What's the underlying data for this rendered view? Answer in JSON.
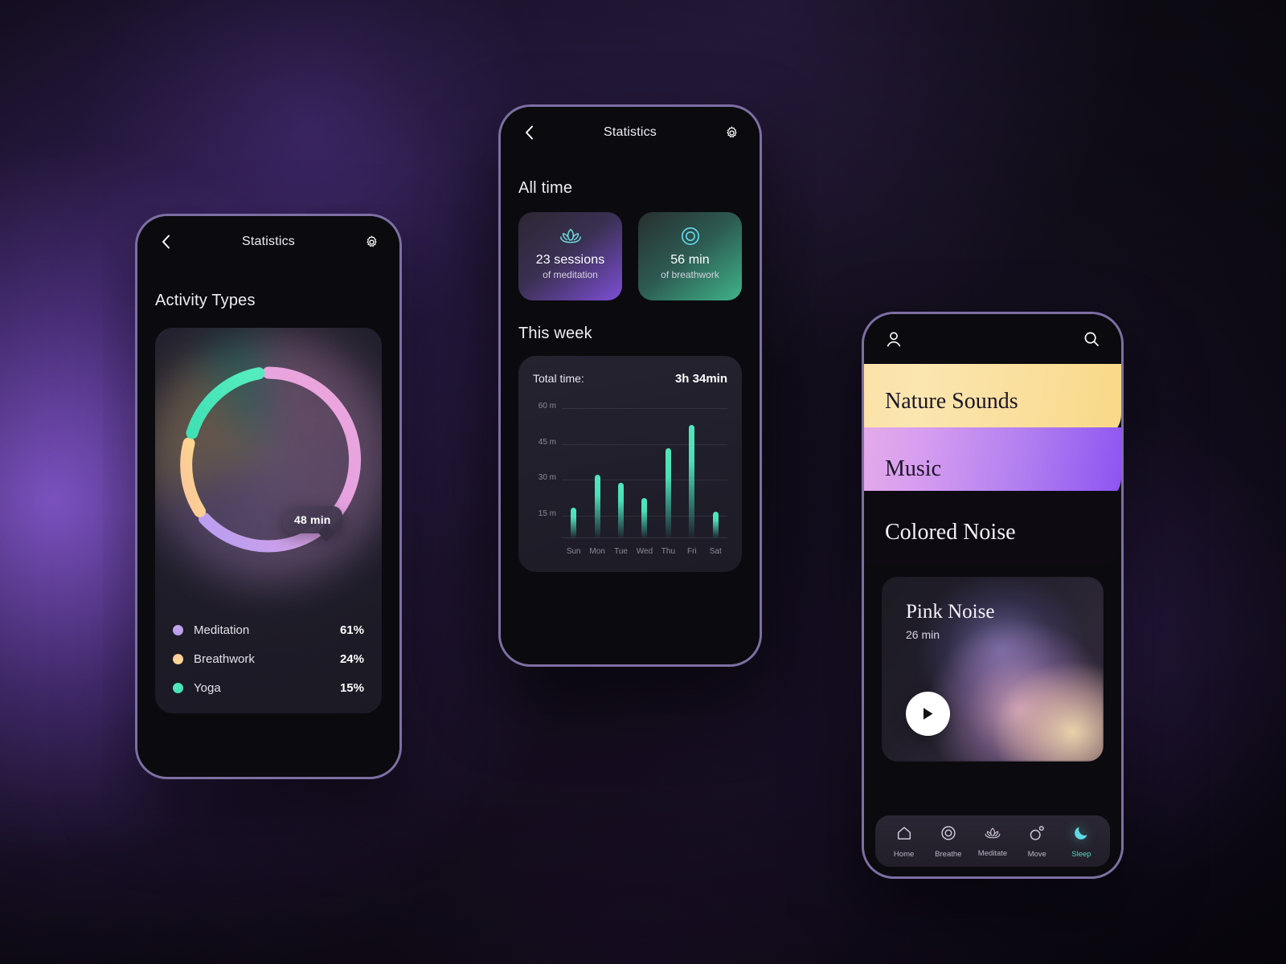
{
  "theme": {
    "accent_purple": "#8d53f2",
    "accent_green": "#4fe8bb",
    "accent_pink": "#eaa4d8",
    "accent_yellow": "#fad98d",
    "accent_lavender": "#bda2ee",
    "bg_dark": "#0b0a0e"
  },
  "phone1": {
    "appbar": {
      "back_icon": "chevron-left-icon",
      "title": "Statistics",
      "settings_icon": "gear-icon"
    },
    "section_title": "Activity Types",
    "tooltip": "48 min",
    "chart_data": {
      "type": "pie",
      "title": "Activity Types",
      "categories": [
        "Meditation",
        "Breathwork",
        "Yoga"
      ],
      "values": [
        61,
        24,
        15
      ],
      "value_unit": "%",
      "colors": [
        "#e9a9dd",
        "#fbd98d",
        "#4fe8bb"
      ],
      "annotation": "48 min",
      "legend_position": "bottom"
    },
    "legend": [
      {
        "label": "Meditation",
        "value": "61%",
        "color": "#bda2ee"
      },
      {
        "label": "Breathwork",
        "value": "24%",
        "color": "#fbd290"
      },
      {
        "label": "Yoga",
        "value": "15%",
        "color": "#4fe8bb"
      }
    ]
  },
  "phone2": {
    "appbar": {
      "back_icon": "chevron-left-icon",
      "title": "Statistics",
      "settings_icon": "gear-icon"
    },
    "all_time_title": "All time",
    "cards": [
      {
        "icon": "lotus-icon",
        "main": "23 sessions",
        "sub": "of meditation"
      },
      {
        "icon": "target-circle-icon",
        "main": "56 min",
        "sub": "of breathwork"
      }
    ],
    "week_title": "This week",
    "total_time_label": "Total time:",
    "total_time_value": "3h 34min",
    "chart_data": {
      "type": "bar",
      "title": "This week",
      "categories": [
        "Sun",
        "Mon",
        "Tue",
        "Wed",
        "Thu",
        "Fri",
        "Sat"
      ],
      "values": [
        16,
        33,
        29,
        21,
        47,
        59,
        14
      ],
      "ylabel": "",
      "xlabel": "",
      "ylim": [
        0,
        68
      ],
      "ytick_values": [
        15,
        30,
        45,
        60
      ],
      "ytick_labels": [
        "15 m",
        "30 m",
        "45 m",
        "60 m"
      ],
      "grid": true,
      "series_color": "#4fe8bb",
      "total": "3h 34min"
    }
  },
  "phone3": {
    "header": {
      "profile_icon": "user-icon",
      "search_icon": "search-icon"
    },
    "categories": [
      {
        "label": "Nature Sounds"
      },
      {
        "label": "Music"
      },
      {
        "label": "Colored Noise"
      }
    ],
    "now_card": {
      "title": "Pink Noise",
      "duration": "26 min",
      "play_icon": "play-icon"
    },
    "tabs": [
      {
        "label": "Home",
        "icon": "home-icon",
        "active": false
      },
      {
        "label": "Breathe",
        "icon": "target-circle-icon",
        "active": false
      },
      {
        "label": "Meditate",
        "icon": "lotus-icon",
        "active": false
      },
      {
        "label": "Move",
        "icon": "move-icon",
        "active": false
      },
      {
        "label": "Sleep",
        "icon": "moon-icon",
        "active": true
      }
    ]
  }
}
